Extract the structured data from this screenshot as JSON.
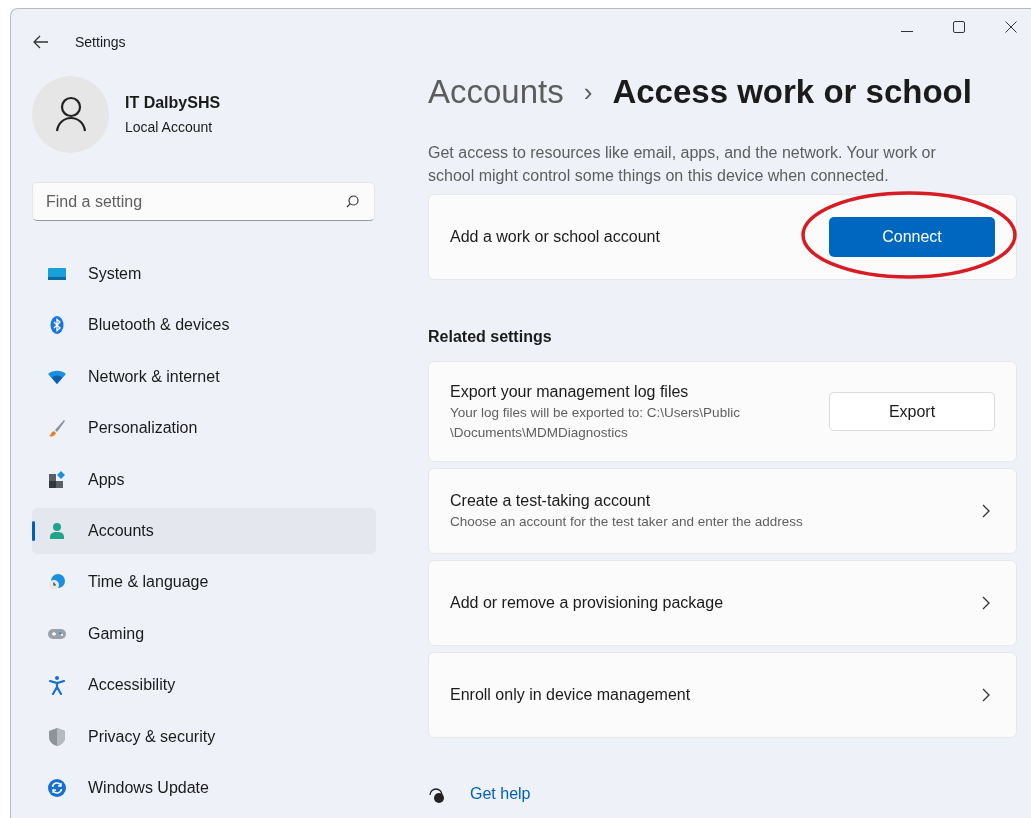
{
  "window": {
    "title": "Settings"
  },
  "profile": {
    "name": "IT DalbySHS",
    "account_type": "Local Account"
  },
  "search": {
    "placeholder": "Find a setting"
  },
  "sidebar": {
    "items": [
      {
        "label": "System",
        "selected": false
      },
      {
        "label": "Bluetooth & devices",
        "selected": false
      },
      {
        "label": "Network & internet",
        "selected": false
      },
      {
        "label": "Personalization",
        "selected": false
      },
      {
        "label": "Apps",
        "selected": false
      },
      {
        "label": "Accounts",
        "selected": true
      },
      {
        "label": "Time & language",
        "selected": false
      },
      {
        "label": "Gaming",
        "selected": false
      },
      {
        "label": "Accessibility",
        "selected": false
      },
      {
        "label": "Privacy & security",
        "selected": false
      },
      {
        "label": "Windows Update",
        "selected": false
      }
    ]
  },
  "breadcrumb": {
    "parent": "Accounts",
    "separator": "›",
    "current": "Access work or school"
  },
  "description": "Get access to resources like email, apps, and the network. Your work or school might control some things on this device when connected.",
  "main_setting": {
    "title": "Add a work or school account",
    "button": "Connect",
    "kind": "primary"
  },
  "related_settings": {
    "heading": "Related settings",
    "items": [
      {
        "kind": "button",
        "title": "Export your management log files",
        "subtitle": "Your log files will be exported to: C:\\Users\\Public \\Documents\\MDMDiagnostics",
        "button": "Export"
      },
      {
        "kind": "link",
        "title": "Create a test-taking account",
        "subtitle": "Choose an account for the test taker and enter the address"
      },
      {
        "kind": "link",
        "title": "Add or remove a provisioning package"
      },
      {
        "kind": "link",
        "title": "Enroll only in device management"
      }
    ]
  },
  "help_link": "Get help"
}
